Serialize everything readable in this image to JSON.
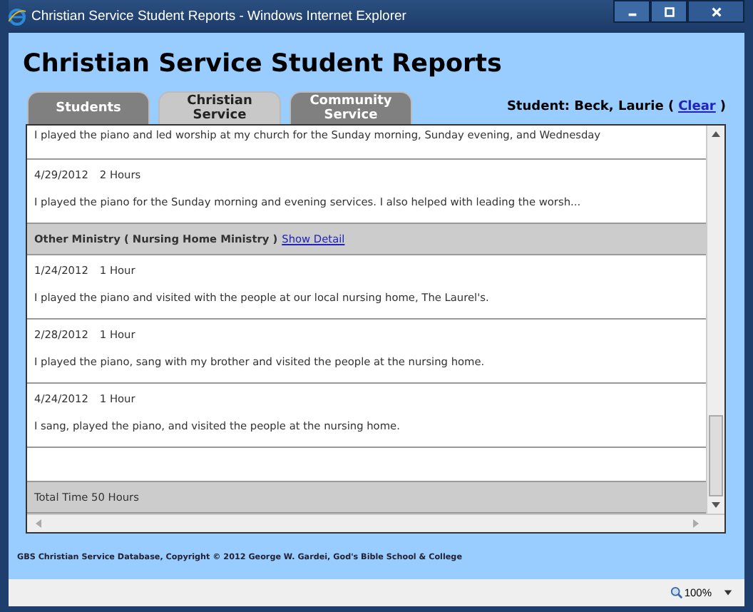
{
  "window": {
    "title": "Christian Service Student Reports - Windows Internet Explorer"
  },
  "page_title": "Christian Service Student Reports",
  "tabs": [
    {
      "label": "Students",
      "selected": false
    },
    {
      "label": "Christian Service",
      "selected": true
    },
    {
      "label": "Community Service",
      "selected": false
    }
  ],
  "student": {
    "label": "Student: Beck, Laurie (",
    "link": "Clear",
    "suffix": ")"
  },
  "entries": [
    {
      "kind": "entry",
      "text": "I played the piano and led worship at my church for the Sunday morning, Sunday evening, and Wednesday"
    },
    {
      "kind": "entry",
      "date": "4/29/2012",
      "hours": "2 Hours",
      "text": "I played the piano for the Sunday morning and evening services. I also helped with leading the worsh..."
    },
    {
      "kind": "header",
      "text": "Other Ministry ( Nursing Home Ministry )",
      "link": "Show Detail"
    },
    {
      "kind": "entry",
      "date": "1/24/2012",
      "hours": "1 Hour",
      "text": "I played the piano and visited with the people at our local nursing home, The Laurel's."
    },
    {
      "kind": "entry",
      "date": "2/28/2012",
      "hours": "1 Hour",
      "text": "I played the piano, sang with my brother and visited the people at the nursing home."
    },
    {
      "kind": "entry",
      "date": "4/24/2012",
      "hours": "1 Hour",
      "text": "I sang, played the piano, and visited the people at the nursing home."
    },
    {
      "kind": "total",
      "text": "Total Time 50 Hours"
    }
  ],
  "footer": "GBS Christian Service Database, Copyright © 2012 George W. Gardei, God's Bible School & College",
  "status_bar": {
    "zoom": "100%"
  }
}
